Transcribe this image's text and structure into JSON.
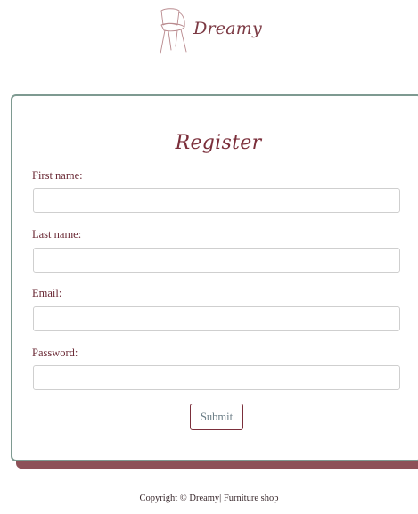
{
  "brand": {
    "logo_icon": "chair-icon",
    "name": "Dreamy",
    "accent_color": "#7b2f3b",
    "border_color": "#7e9a91"
  },
  "form": {
    "title": "Register",
    "fields": [
      {
        "label": "First name:",
        "value": "",
        "placeholder": ""
      },
      {
        "label": "Last name:",
        "value": "",
        "placeholder": ""
      },
      {
        "label": "Email:",
        "value": "",
        "placeholder": ""
      },
      {
        "label": "Password:",
        "value": "",
        "placeholder": ""
      }
    ],
    "submit_label": "Submit"
  },
  "footer": {
    "text": "Copyright © Dreamy| Furniture shop"
  }
}
